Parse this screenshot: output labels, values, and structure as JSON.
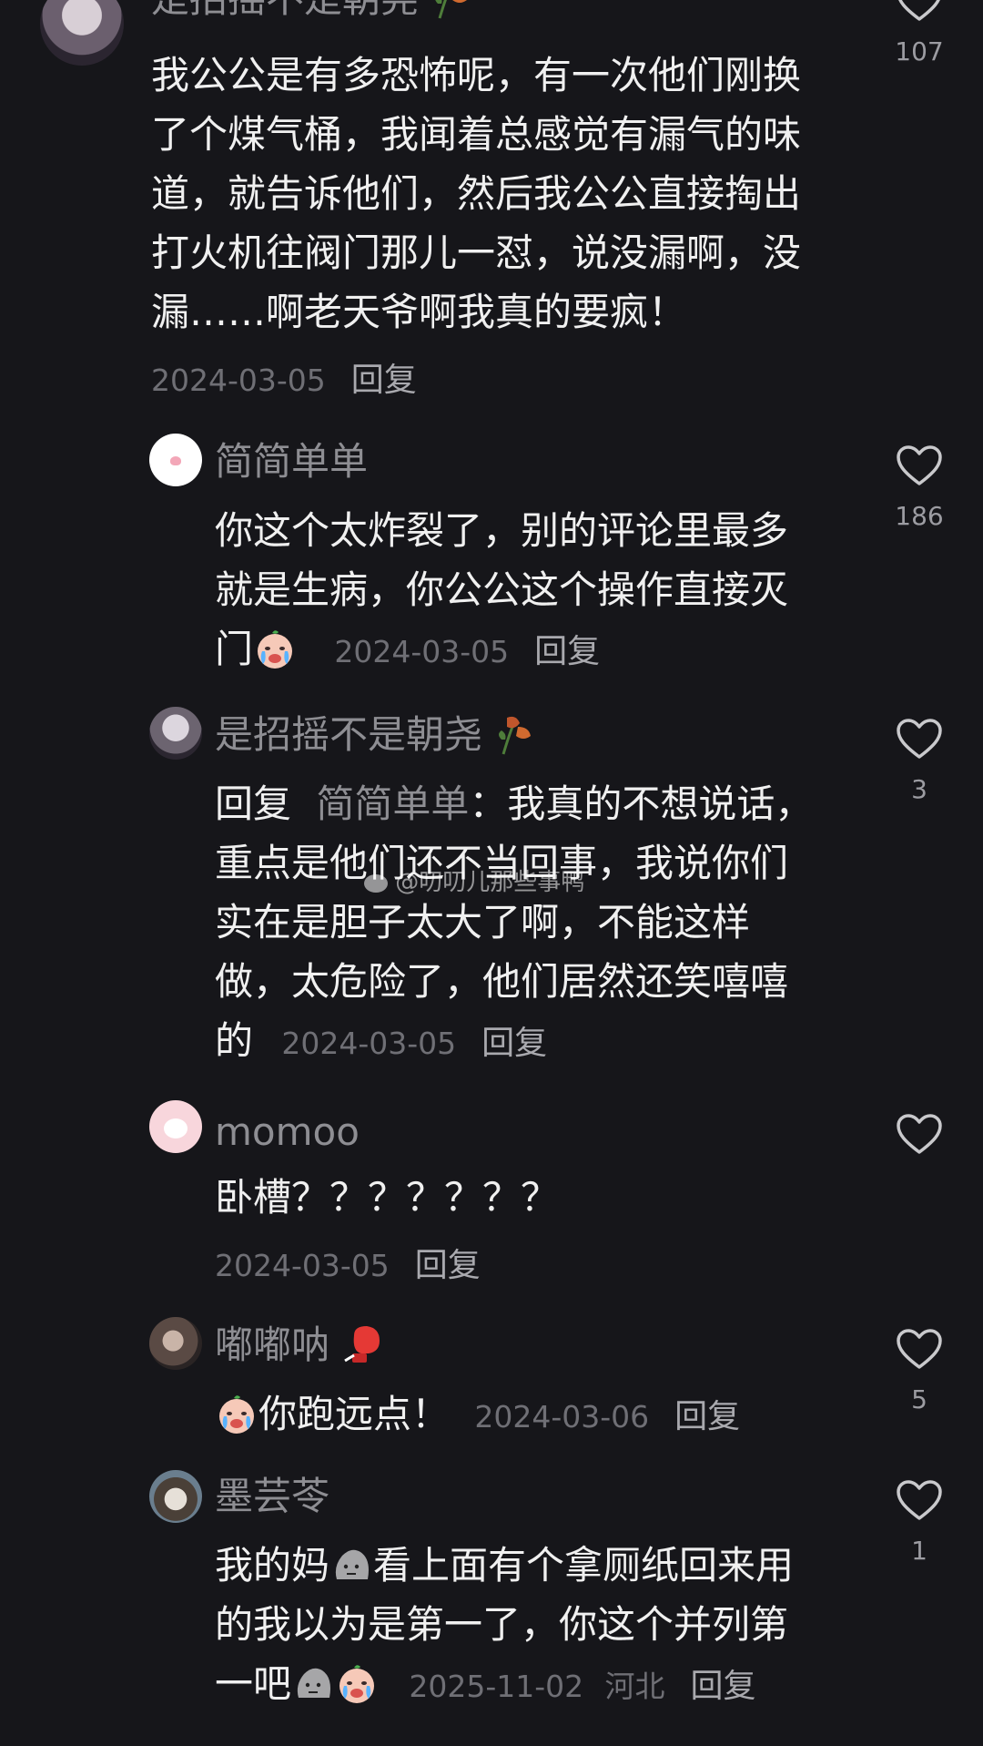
{
  "comments": [
    {
      "user": "是招摇不是朝尧",
      "text_lines": [
        "我公公是有多恐怖呢，有一次他们刚换",
        "了个煤气桶，我闻着总感觉有漏气的味",
        "道，就告诉他们，然后我公公直接掏出",
        "打火机往阀门那儿一怼，说没漏啊，没",
        "漏……啊老天爷啊我真的要疯！"
      ],
      "date": "2024-03-05",
      "reply_label": "回复",
      "likes": "107"
    },
    {
      "user": "简简单单",
      "text_lines": [
        "你这个太炸裂了，别的评论里最多",
        "就是生病，你公公这个操作直接灭",
        "门"
      ],
      "date": "2024-03-05",
      "reply_label": "回复",
      "likes": "186"
    },
    {
      "user": "是招摇不是朝尧",
      "reply_prefix": "回复",
      "reply_target": "简简单单",
      "text_first": "：我真的不想说话，",
      "text_lines": [
        "重点是他们还不当回事，我说你们",
        "实在是胆子太大了啊，不能这样",
        "做，太危险了，他们居然还笑嘻嘻",
        "的"
      ],
      "date": "2024-03-05",
      "reply_label": "回复",
      "likes": "3"
    },
    {
      "user": "momoo",
      "text": "卧槽？？？？？？？",
      "date": "2024-03-05",
      "reply_label": "回复",
      "likes": ""
    },
    {
      "user": "嘟嘟呐",
      "text": "你跑远点！",
      "date": "2024-03-06",
      "reply_label": "回复",
      "likes": "5"
    },
    {
      "user": "墨芸苓",
      "text_lines": [
        "我的妈",
        "看上面有个拿厕纸回来用",
        "的我以为是第一了，你这个并列第",
        "一吧"
      ],
      "date": "2025-11-02",
      "location": "河北",
      "reply_label": "回复",
      "likes": "1"
    }
  ],
  "watermark": "@叨叨儿那些事鸭",
  "colors": {
    "background": "#16161a",
    "text": "#f0f0f0",
    "muted": "#8e8e93",
    "meta": "#6f6f75"
  },
  "icons": [
    "heart-outline-icon",
    "crying-face-emoji",
    "stone-face-emoji",
    "boxing-glove-emoji",
    "wilted-flower-emoji",
    "weibo-icon"
  ]
}
